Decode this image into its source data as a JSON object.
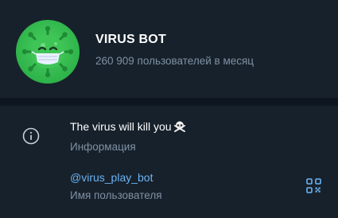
{
  "profile": {
    "name": "VIRUS BOT",
    "subtitle": "260 909 пользователей в месяц",
    "avatar_icon": "virus-mascot-icon"
  },
  "info": {
    "bio": "The virus will kill you",
    "bio_emoji": "skull-crossbones",
    "bio_label": "Информация",
    "username": "@virus_play_bot",
    "username_label": "Имя пользователя"
  },
  "colors": {
    "background": "#17212b",
    "divider": "#0e1621",
    "primary_text": "#ffffff",
    "secondary_text": "#7f91a4",
    "link": "#6ab3f3",
    "avatar_green": "#2eb34a"
  }
}
